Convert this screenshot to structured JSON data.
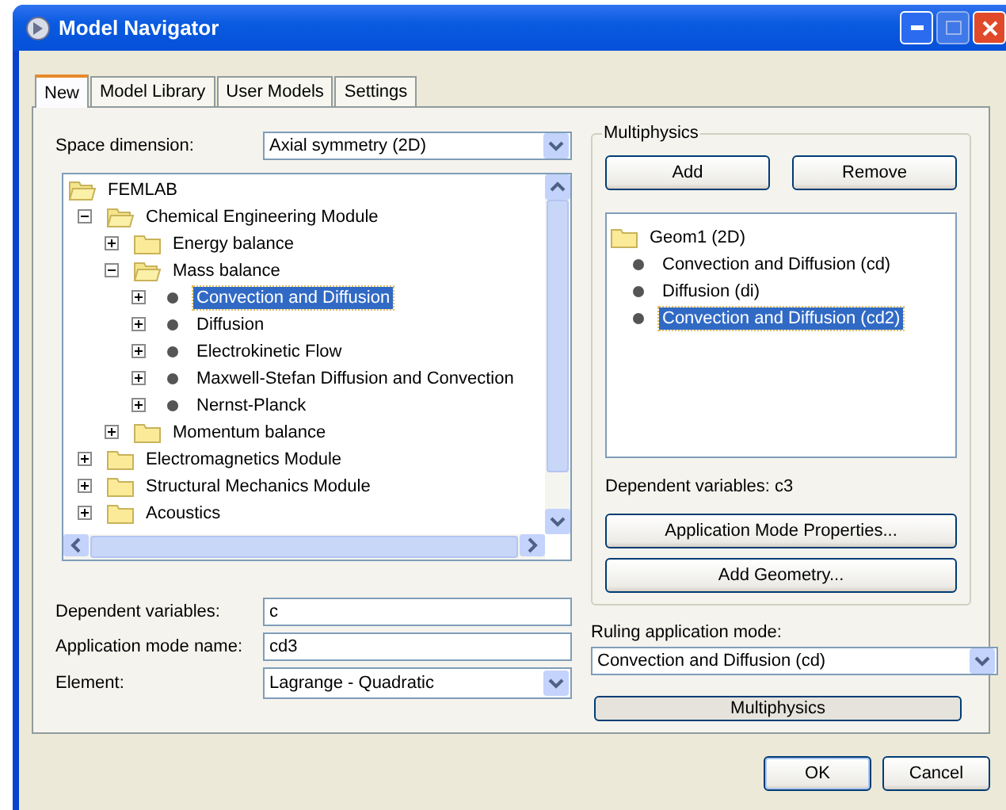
{
  "window": {
    "title": "Model Navigator"
  },
  "tabs": [
    {
      "label": "New",
      "selected": true
    },
    {
      "label": "Model Library",
      "selected": false
    },
    {
      "label": "User Models",
      "selected": false
    },
    {
      "label": "Settings",
      "selected": false
    }
  ],
  "space_dimension": {
    "label": "Space dimension:",
    "value": "Axial symmetry (2D)"
  },
  "model_tree": {
    "root": "FEMLAB",
    "items": [
      {
        "label": "Chemical Engineering Module",
        "kind": "folder",
        "expanded": true,
        "selected": false,
        "children": [
          {
            "label": "Energy balance",
            "kind": "folder",
            "expanded": false,
            "selected": false
          },
          {
            "label": "Mass balance",
            "kind": "folder",
            "expanded": true,
            "selected": false,
            "children": [
              {
                "label": "Convection and Diffusion",
                "kind": "mode",
                "expanded": false,
                "selected": true
              },
              {
                "label": "Diffusion",
                "kind": "mode",
                "expanded": false,
                "selected": false
              },
              {
                "label": "Electrokinetic Flow",
                "kind": "mode",
                "expanded": false,
                "selected": false
              },
              {
                "label": "Maxwell-Stefan Diffusion and Convection",
                "kind": "mode",
                "expanded": false,
                "selected": false
              },
              {
                "label": "Nernst-Planck",
                "kind": "mode",
                "expanded": false,
                "selected": false
              }
            ]
          },
          {
            "label": "Momentum balance",
            "kind": "folder",
            "expanded": false,
            "selected": false
          }
        ]
      },
      {
        "label": "Electromagnetics Module",
        "kind": "folder",
        "expanded": false,
        "selected": false
      },
      {
        "label": "Structural Mechanics Module",
        "kind": "folder",
        "expanded": false,
        "selected": false
      },
      {
        "label": "Acoustics",
        "kind": "folder",
        "expanded": false,
        "selected": false
      }
    ]
  },
  "fields": [
    {
      "label": "Dependent variables:",
      "value": "c",
      "kind": "text"
    },
    {
      "label": "Application mode name:",
      "value": "cd3",
      "kind": "text"
    },
    {
      "label": "Element:",
      "value": "Lagrange - Quadratic",
      "kind": "select"
    }
  ],
  "multiphysics": {
    "title": "Multiphysics",
    "add": "Add",
    "remove": "Remove",
    "root": "Geom1 (2D)",
    "items": [
      {
        "label": "Convection and Diffusion (cd)",
        "selected": false
      },
      {
        "label": "Diffusion (di)",
        "selected": false
      },
      {
        "label": "Convection and Diffusion (cd2)",
        "selected": true
      }
    ],
    "dependent_variables": "Dependent variables:  c3",
    "buttons": [
      "Application Mode Properties...",
      "Add Geometry..."
    ]
  },
  "ruling_mode": {
    "label": "Ruling application mode:",
    "value": "Convection and Diffusion (cd)"
  },
  "multiphysics_button": "Multiphysics",
  "buttons": [
    "OK",
    "Cancel"
  ]
}
